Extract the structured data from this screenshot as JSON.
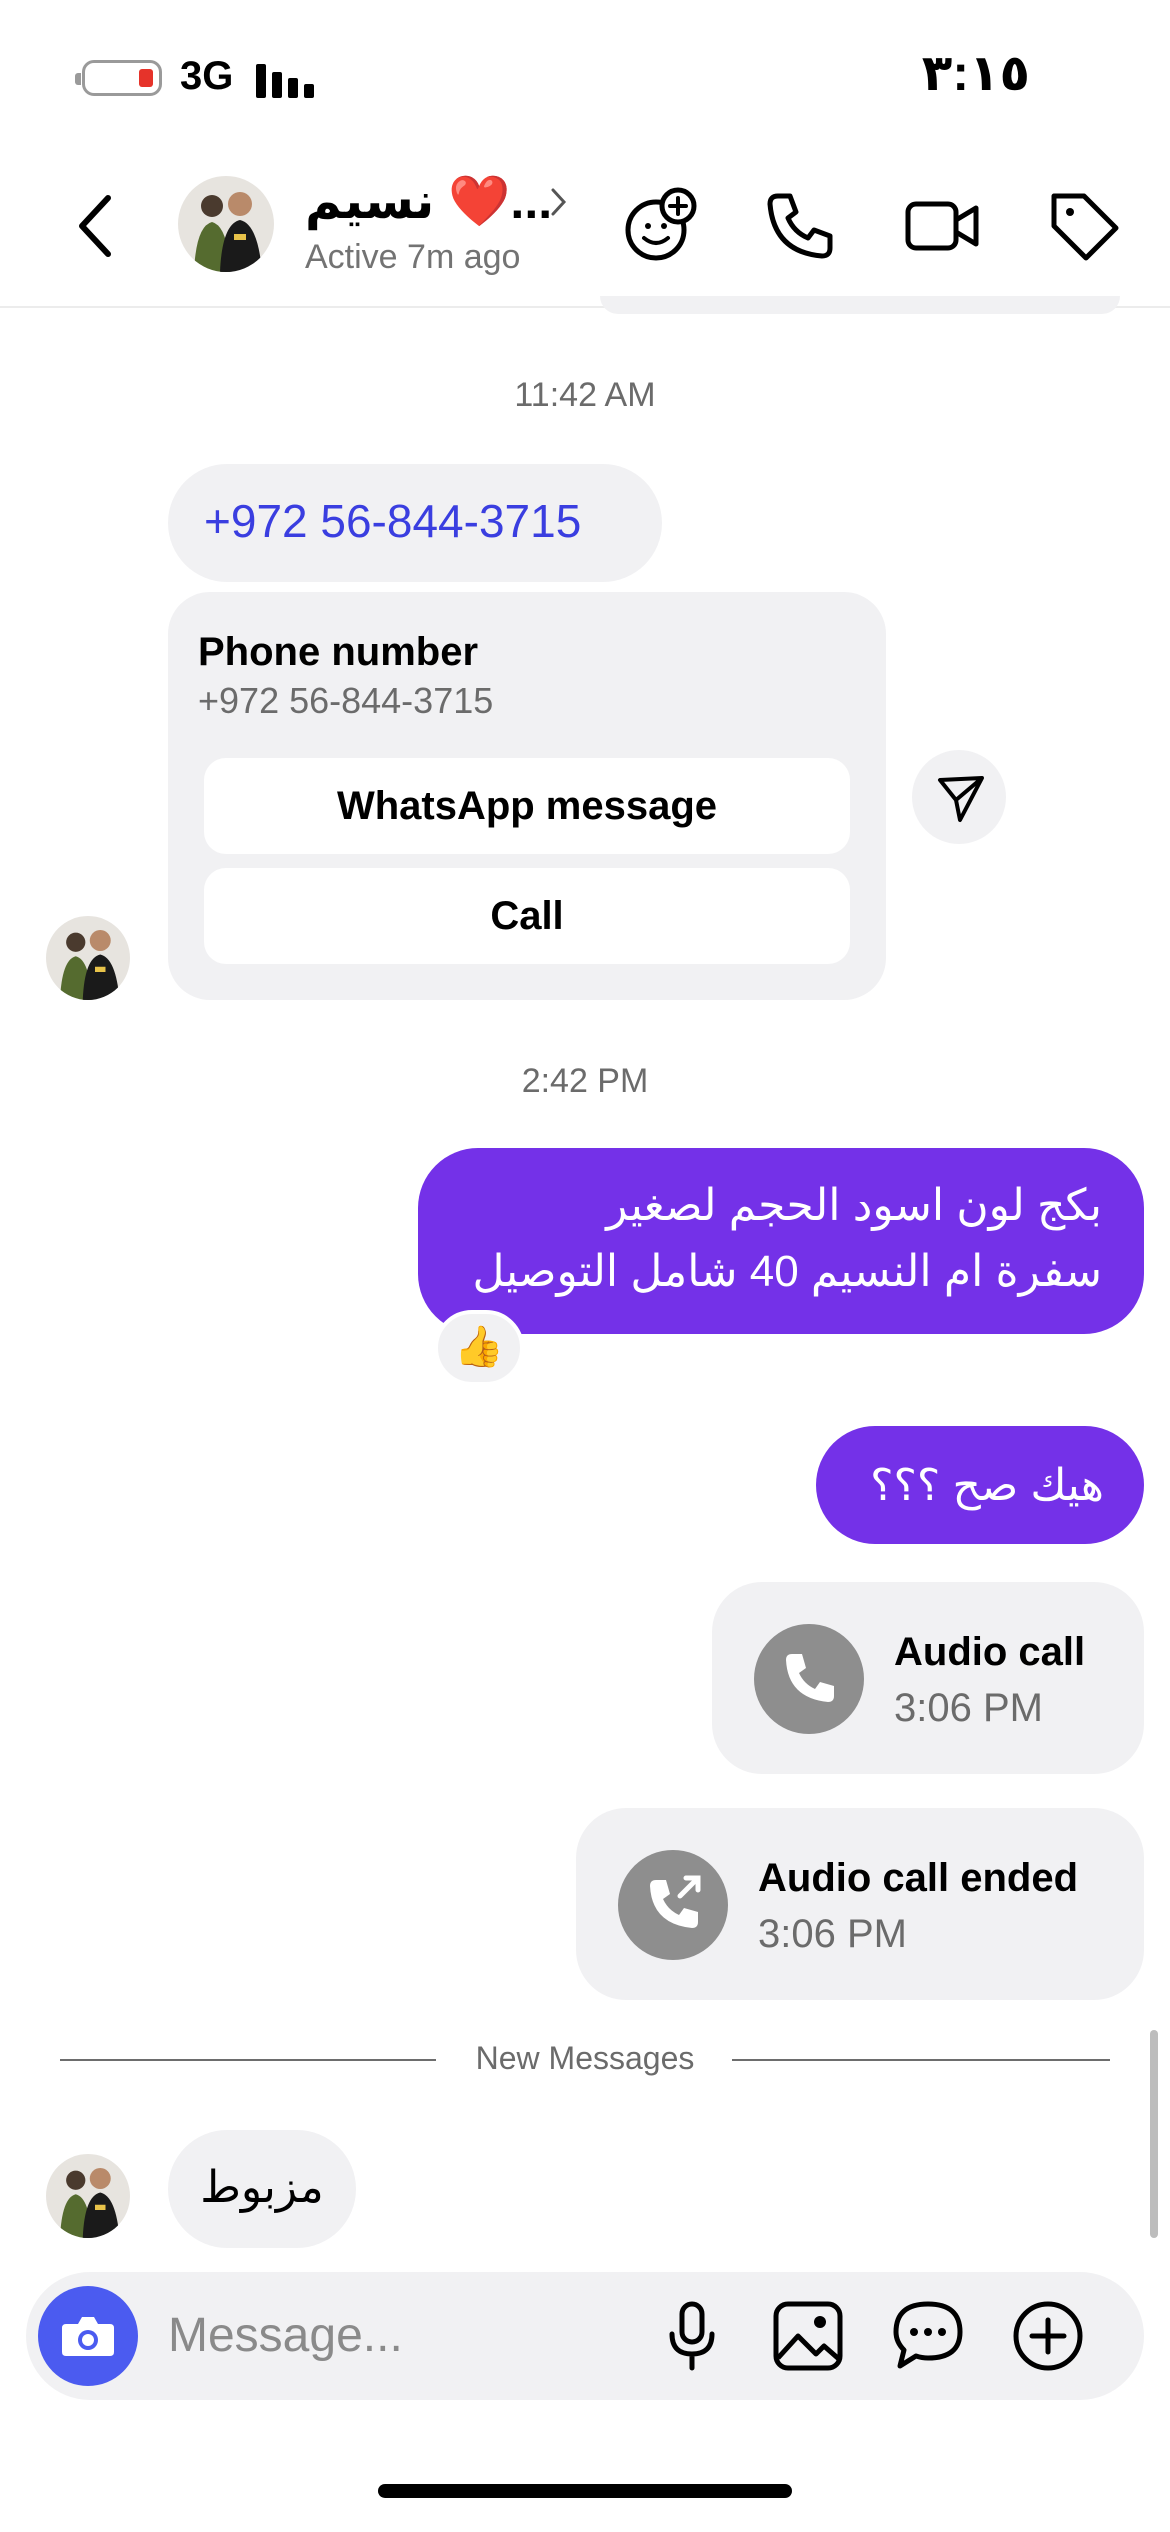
{
  "status_bar": {
    "network": "3G",
    "time": "٣:١٥",
    "battery_color": "#e6332a"
  },
  "header": {
    "contact_name": "نسيم ❤️...",
    "status": "Active 7m ago",
    "icons": [
      "back-chevron-icon",
      "add-friend-icon",
      "phone-icon",
      "video-camera-icon",
      "tag-icon"
    ]
  },
  "messages": {
    "timestamp_1": "11:42 AM",
    "phone_link": "+972 56-844-3715",
    "card": {
      "title": "Phone number",
      "subtitle": "+972 56-844-3715",
      "whatsapp_button": "WhatsApp message",
      "call_button": "Call"
    },
    "timestamp_2": "2:42 PM",
    "sent_1_line_1": "بكج لون اسود الحجم لصغير",
    "sent_1_line_2": "سفرة ام النسيم 40  شامل التوصيل",
    "reaction": "👍",
    "sent_2": "هيك صح ؟؟؟",
    "audio_call": {
      "label": "Audio call",
      "time": "3:06 PM"
    },
    "audio_call_ended": {
      "label": "Audio call ended",
      "time": "3:06 PM"
    },
    "new_messages_divider": "New Messages",
    "received": "مزبوط"
  },
  "composer": {
    "placeholder": "Message...",
    "icons": [
      "camera-icon",
      "microphone-icon",
      "image-icon",
      "sticker-icon",
      "plus-icon"
    ]
  },
  "colors": {
    "sent_bubble": "#7431e8",
    "link": "#3a3ee0",
    "camera_button": "#4b5bf0",
    "received_bubble": "#f1f1f3"
  }
}
